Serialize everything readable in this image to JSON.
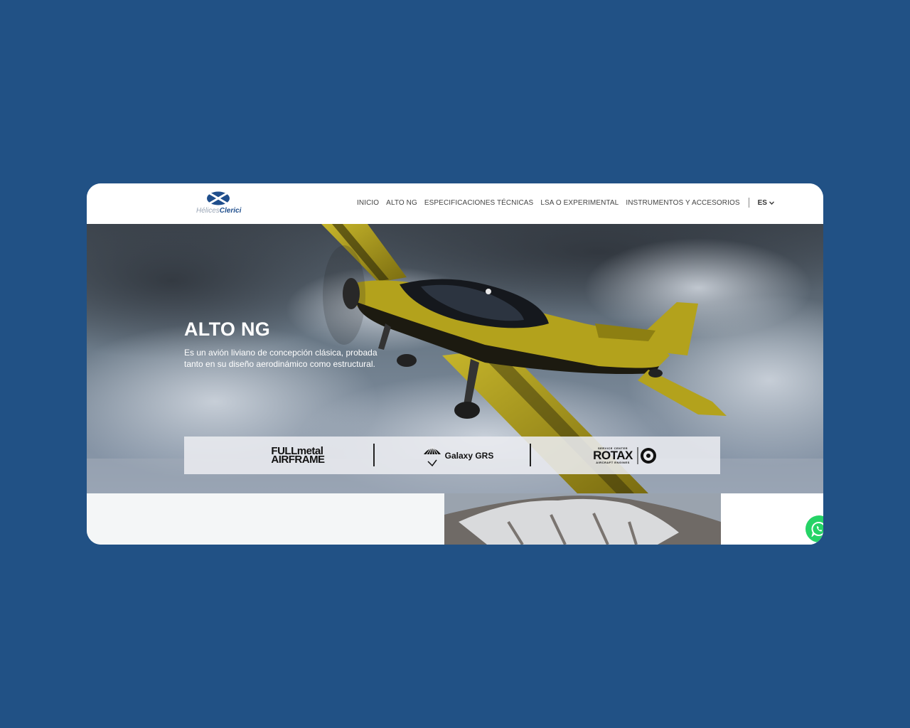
{
  "brand": {
    "part1": "Hélices",
    "part2": "Clerici",
    "accent": "#1f4e8c"
  },
  "nav": {
    "items": [
      {
        "label": "INICIO"
      },
      {
        "label": "ALTO NG"
      },
      {
        "label": "ESPECIFICACIONES TÉCNICAS"
      },
      {
        "label": "LSA O EXPERIMENTAL"
      },
      {
        "label": "INSTRUMENTOS Y ACCESORIOS"
      }
    ],
    "language": "ES",
    "language_icon": "chevron-down-icon"
  },
  "hero": {
    "title": "ALTO NG",
    "description": "Es un avión liviano de concepción clásica, probada tanto en su diseño aerodinámico como estructural."
  },
  "partners": {
    "fullmetal_line1": "FULLmetal",
    "fullmetal_line2": "AIRFRAME",
    "galaxy": "Galaxy GRS",
    "rotax_top": "SERVICE CENTER",
    "rotax": "ROTAX",
    "rotax_bottom": "AIRCRAFT ENGINES"
  },
  "whatsapp": {
    "icon": "whatsapp-icon",
    "color": "#25d366"
  },
  "colors": {
    "page_background": "#215185",
    "plane": "#b3a21c"
  }
}
